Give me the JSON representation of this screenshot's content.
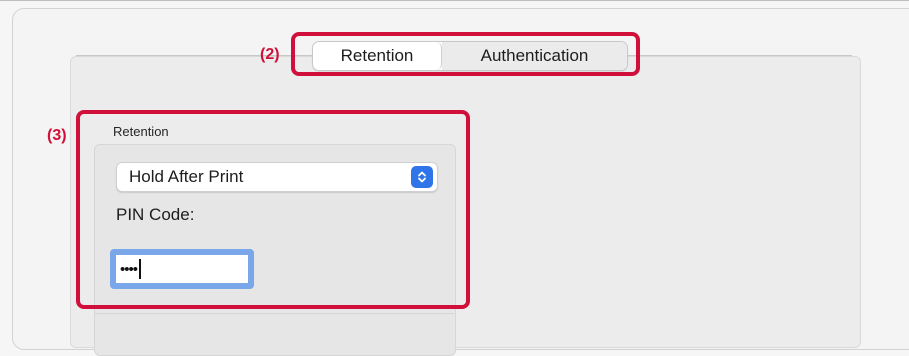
{
  "tabs": [
    {
      "label": "Retention",
      "selected": true
    },
    {
      "label": "Authentication",
      "selected": false
    }
  ],
  "markers": {
    "tabs": "(2)",
    "retention_group": "(3)"
  },
  "retention": {
    "section_label": "Retention",
    "mode": {
      "value": "Hold After Print",
      "icon": "updown-arrows-icon"
    },
    "pin": {
      "label": "PIN Code:",
      "masked_value": "••••"
    }
  },
  "colors": {
    "highlight": "#d0103a",
    "accent": "#2f74e8",
    "focus_ring": "#7aa7ea"
  }
}
